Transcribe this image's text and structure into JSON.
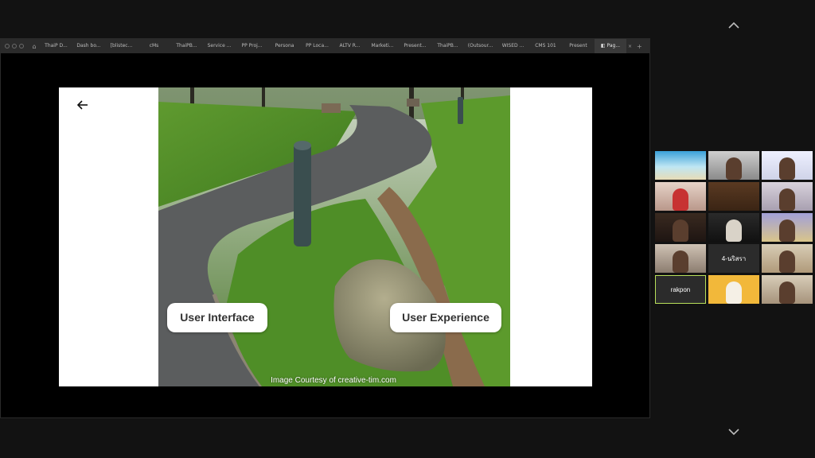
{
  "browser": {
    "tabs": [
      "ThaiP D...",
      "Dash bo...",
      "[blistec...",
      "cMs",
      "ThaiPB...",
      "Service ...",
      "PP Proj...",
      "Persona",
      "PP Loca...",
      "ALTV R...",
      "Marketi...",
      "Present...",
      "ThaiPB...",
      "(Outsour...",
      "WISED ...",
      "CMS 101",
      "Present"
    ],
    "active_tab": "Pag...",
    "close_glyph": "×",
    "new_tab_glyph": "+",
    "home_icon": "home-icon"
  },
  "slide": {
    "back_icon": "arrow-left-icon",
    "chip_left": "User Interface",
    "chip_right": "User Experience",
    "credit": "Image Courtesy of creative-tim.com"
  },
  "participants": [
    {
      "name": "",
      "label": "beach"
    },
    {
      "name": "",
      "label": ""
    },
    {
      "name": "",
      "label": ""
    },
    {
      "name": "",
      "label": ""
    },
    {
      "name": "",
      "label": ""
    },
    {
      "name": "",
      "label": ""
    },
    {
      "name": "",
      "label": ""
    },
    {
      "name": "",
      "label": ""
    },
    {
      "name": "",
      "label": ""
    },
    {
      "name": "",
      "label": ""
    },
    {
      "name": "4-นริสรา",
      "label": ""
    },
    {
      "name": "",
      "label": ""
    },
    {
      "name": "rakpon",
      "label": ""
    },
    {
      "name": "",
      "label": ""
    },
    {
      "name": "",
      "label": ""
    }
  ],
  "colors": {
    "speaker_highlight": "#b8e05a",
    "background": "#121212"
  }
}
